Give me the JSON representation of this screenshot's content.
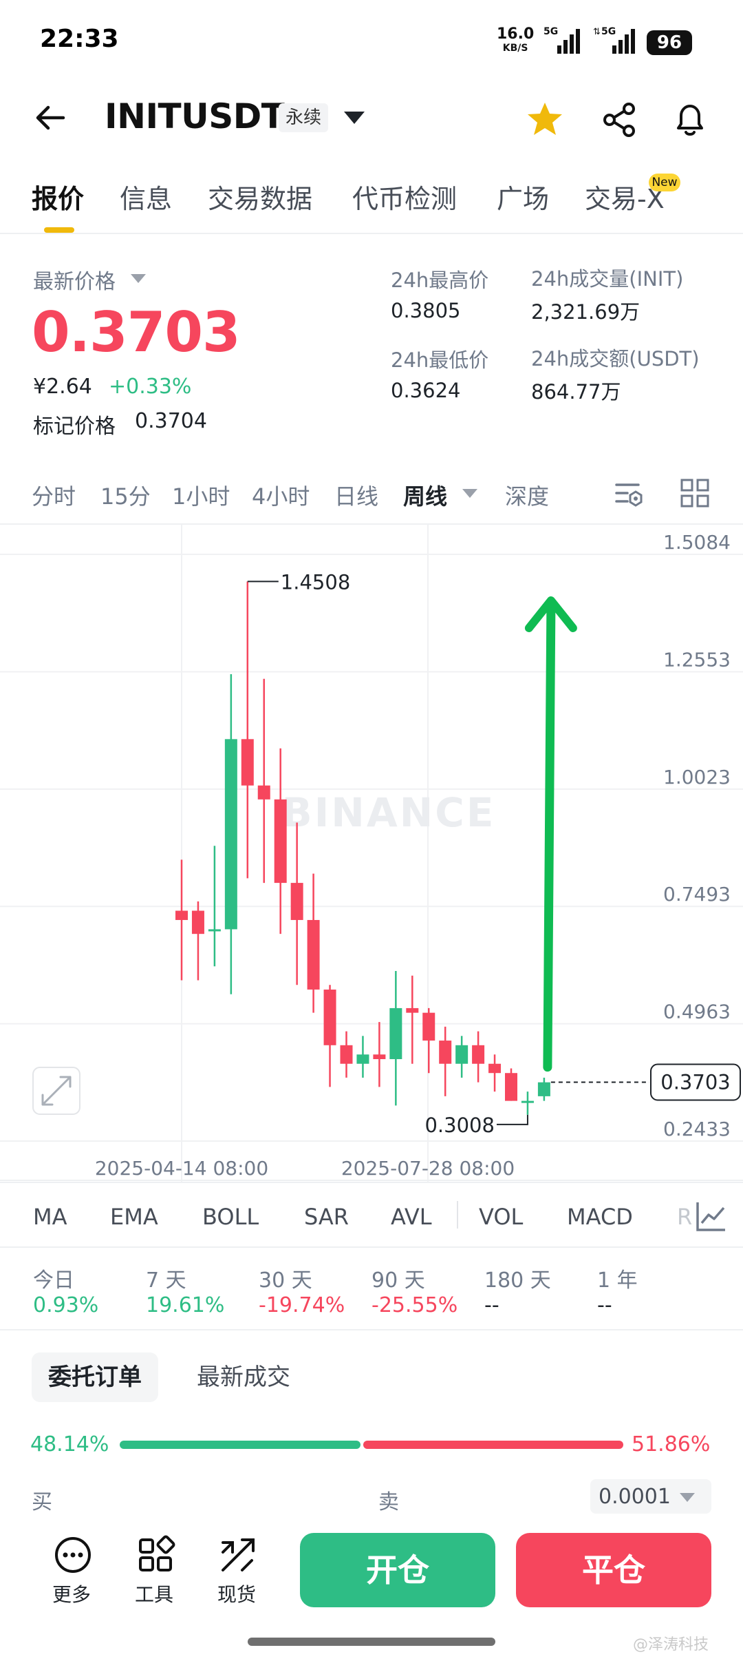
{
  "status_bar": {
    "time": "22:33",
    "net_speed": "16.0",
    "net_unit": "KB/S",
    "signal1": "5G",
    "signal2": "5G",
    "battery": "96"
  },
  "header": {
    "symbol": "INITUSDT",
    "contract_type": "永续",
    "icons": [
      "back-icon",
      "caret-down-icon",
      "star-icon",
      "share-icon",
      "bell-icon"
    ],
    "star_color": "#f0b90b"
  },
  "tabs": [
    {
      "label": "报价",
      "active": true
    },
    {
      "label": "信息"
    },
    {
      "label": "交易数据"
    },
    {
      "label": "代币检测"
    },
    {
      "label": "广场"
    },
    {
      "label": "交易-X",
      "badge": "New"
    }
  ],
  "price": {
    "last_label": "最新价格",
    "last": "0.3703",
    "cny": "¥2.64",
    "change": "+0.33%",
    "mark_label": "标记价格",
    "mark": "0.3704"
  },
  "stats": {
    "high_label": "24h最高价",
    "high": "0.3805",
    "low_label": "24h最低价",
    "low": "0.3624",
    "vol_label": "24h成交量(INIT)",
    "vol": "2,321.69万",
    "amt_label": "24h成交额(USDT)",
    "amt": "864.77万"
  },
  "intervals": [
    "分时",
    "15分",
    "1小时",
    "4小时",
    "日线",
    "周线",
    "深度"
  ],
  "active_interval": "周线",
  "chart_data": {
    "type": "candlestick",
    "watermark": "BINANCE",
    "y_ticks": [
      "1.5084",
      "1.2553",
      "1.0023",
      "0.7493",
      "0.4963",
      "0.2433"
    ],
    "ylim": [
      0.2433,
      1.5084
    ],
    "x_ticks": [
      "2025-04-14 08:00",
      "2025-07-28 08:00"
    ],
    "high_label": "1.4508",
    "low_label": "0.3008",
    "current_label": "0.3703",
    "candles": [
      [
        0.74,
        0.72,
        0.85,
        0.59
      ],
      [
        0.74,
        0.69,
        0.76,
        0.59
      ],
      [
        0.7,
        0.7,
        0.88,
        0.62
      ],
      [
        0.7,
        1.11,
        1.25,
        0.56
      ],
      [
        1.11,
        1.01,
        1.45,
        0.81
      ],
      [
        1.01,
        0.98,
        1.24,
        0.8
      ],
      [
        0.98,
        0.8,
        1.09,
        0.69
      ],
      [
        0.8,
        0.72,
        0.93,
        0.58
      ],
      [
        0.72,
        0.57,
        0.82,
        0.52
      ],
      [
        0.57,
        0.45,
        0.58,
        0.36
      ],
      [
        0.45,
        0.41,
        0.48,
        0.38
      ],
      [
        0.41,
        0.43,
        0.47,
        0.38
      ],
      [
        0.43,
        0.42,
        0.5,
        0.36
      ],
      [
        0.42,
        0.53,
        0.61,
        0.32
      ],
      [
        0.53,
        0.52,
        0.6,
        0.41
      ],
      [
        0.52,
        0.46,
        0.53,
        0.39
      ],
      [
        0.46,
        0.41,
        0.49,
        0.34
      ],
      [
        0.41,
        0.45,
        0.47,
        0.38
      ],
      [
        0.45,
        0.41,
        0.48,
        0.37
      ],
      [
        0.41,
        0.39,
        0.43,
        0.35
      ],
      [
        0.39,
        0.33,
        0.4,
        0.33
      ],
      [
        0.33,
        0.33,
        0.35,
        0.3
      ],
      [
        0.34,
        0.37,
        0.38,
        0.33
      ]
    ],
    "up_color": "#2ebd85",
    "down_color": "#f6465d",
    "arrow_color": "#0fbb52"
  },
  "indicators": [
    "MA",
    "EMA",
    "BOLL",
    "SAR",
    "AVL",
    "VOL",
    "MACD",
    "R"
  ],
  "performance": [
    {
      "label": "今日",
      "value": "0.93%",
      "tone": "pos"
    },
    {
      "label": "7 天",
      "value": "19.61%",
      "tone": "pos"
    },
    {
      "label": "30 天",
      "value": "-19.74%",
      "tone": "neg"
    },
    {
      "label": "90 天",
      "value": "-25.55%",
      "tone": "neg"
    },
    {
      "label": "180 天",
      "value": "--",
      "tone": "flat"
    },
    {
      "label": "1 年",
      "value": "--",
      "tone": "flat"
    }
  ],
  "orderbook": {
    "tab_orders": "委托订单",
    "tab_trades": "最新成交",
    "buy_pct": "48.14%",
    "sell_pct": "51.86%",
    "buy_fraction": 0.4814,
    "buy_label": "买",
    "sell_label": "卖",
    "precision": "0.0001"
  },
  "bottom_nav": [
    {
      "label": "更多",
      "icon": "more-icon"
    },
    {
      "label": "工具",
      "icon": "tools-icon"
    },
    {
      "label": "现货",
      "icon": "spot-icon"
    }
  ],
  "actions": {
    "open": "开仓",
    "close": "平仓"
  },
  "watermark_text": "@泽涛科技"
}
